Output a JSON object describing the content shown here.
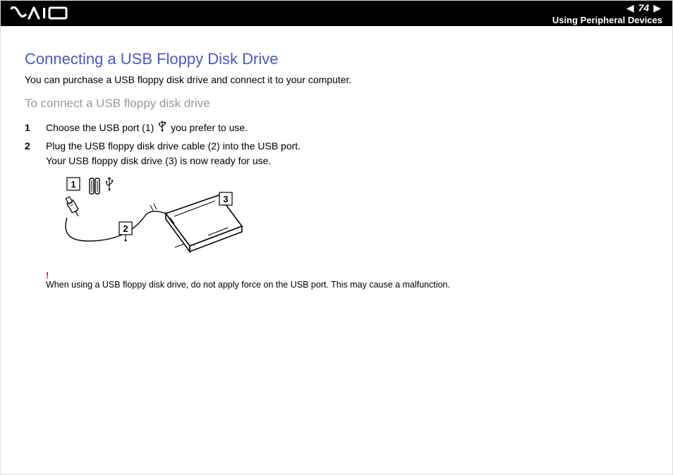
{
  "header": {
    "page_number": "74",
    "section": "Using Peripheral Devices"
  },
  "title": "Connecting a USB Floppy Disk Drive",
  "intro": "You can purchase a USB floppy disk drive and connect it to your computer.",
  "subtitle": "To connect a USB floppy disk drive",
  "steps": {
    "s1_a": "Choose the USB port (1) ",
    "s1_b": " you prefer to use.",
    "s2_a": "Plug the USB floppy disk drive cable (2) into the USB port.",
    "s2_b": "Your USB floppy disk drive (3) is now ready for use."
  },
  "diagram": {
    "label1": "1",
    "label2": "2",
    "label3": "3"
  },
  "warning": {
    "icon": "!",
    "text": "When using a USB floppy disk drive, do not apply force on the USB port. This may cause a malfunction."
  }
}
